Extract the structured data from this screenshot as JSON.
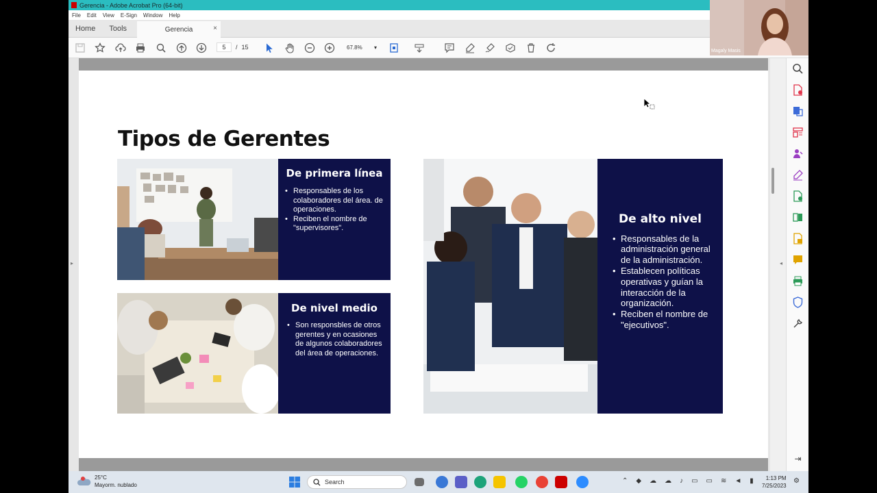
{
  "window": {
    "title": "Gerencia - Adobe Acrobat Pro (64-bit)",
    "menu": [
      "File",
      "Edit",
      "View",
      "E-Sign",
      "Window",
      "Help"
    ],
    "nav_tabs": [
      "Home",
      "Tools"
    ],
    "doc_tab": "Gerencia",
    "doc_tab_close": "×"
  },
  "toolbar": {
    "current_page": "5",
    "page_separator": "/",
    "total_pages": "15",
    "zoom": "67.8%"
  },
  "slide": {
    "title": "Tipos de Gerentes",
    "panels": [
      {
        "heading": "De primera línea",
        "bullets": [
          "Responsables de los colaboradores del área. de operaciones.",
          "Reciben el nombre de \"supervisores\"."
        ]
      },
      {
        "heading": "De nivel medio",
        "bullets": [
          "Son responsbles de otros gerentes y en ocasiones de algunos colaboradores del área de operaciones."
        ]
      },
      {
        "heading": "De alto nivel",
        "bullets": [
          "Responsables de la administración general de la administración.",
          "Establecen políticas operativas y guían la interacción de la organización.",
          "Reciben el nombre de \"ejecutivos\"."
        ]
      }
    ]
  },
  "webcam": {
    "name": "Magaly Masis"
  },
  "taskbar": {
    "weather_temp": "25°C",
    "weather_desc": "Mayorm. nublado",
    "search_label": "Search",
    "time": "1:13 PM",
    "date": "7/25/2023"
  },
  "colors": {
    "titlebar": "#2bbdc0",
    "panel_navy": "#0e1148",
    "acrobat_red": "#cc0000"
  }
}
